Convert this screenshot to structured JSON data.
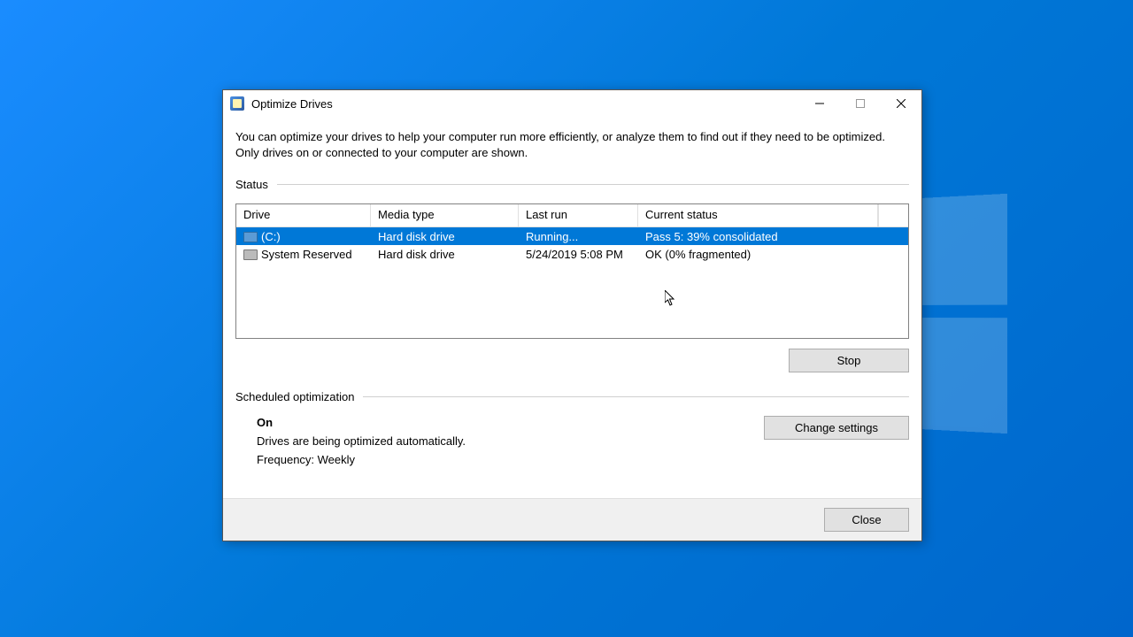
{
  "window": {
    "title": "Optimize Drives",
    "description": "You can optimize your drives to help your computer run more efficiently, or analyze them to find out if they need to be optimized. Only drives on or connected to your computer are shown."
  },
  "status": {
    "label": "Status",
    "columns": {
      "drive": "Drive",
      "media": "Media type",
      "last": "Last run",
      "status": "Current status"
    },
    "rows": [
      {
        "drive": "(C:)",
        "media": "Hard disk drive",
        "last": "Running...",
        "status": "Pass 5: 39% consolidated",
        "selected": true
      },
      {
        "drive": "System Reserved",
        "media": "Hard disk drive",
        "last": "5/24/2019 5:08 PM",
        "status": "OK (0% fragmented)",
        "selected": false
      }
    ]
  },
  "buttons": {
    "stop": "Stop",
    "change": "Change settings",
    "close": "Close"
  },
  "scheduled": {
    "label": "Scheduled optimization",
    "state": "On",
    "desc": "Drives are being optimized automatically.",
    "freq": "Frequency: Weekly"
  }
}
